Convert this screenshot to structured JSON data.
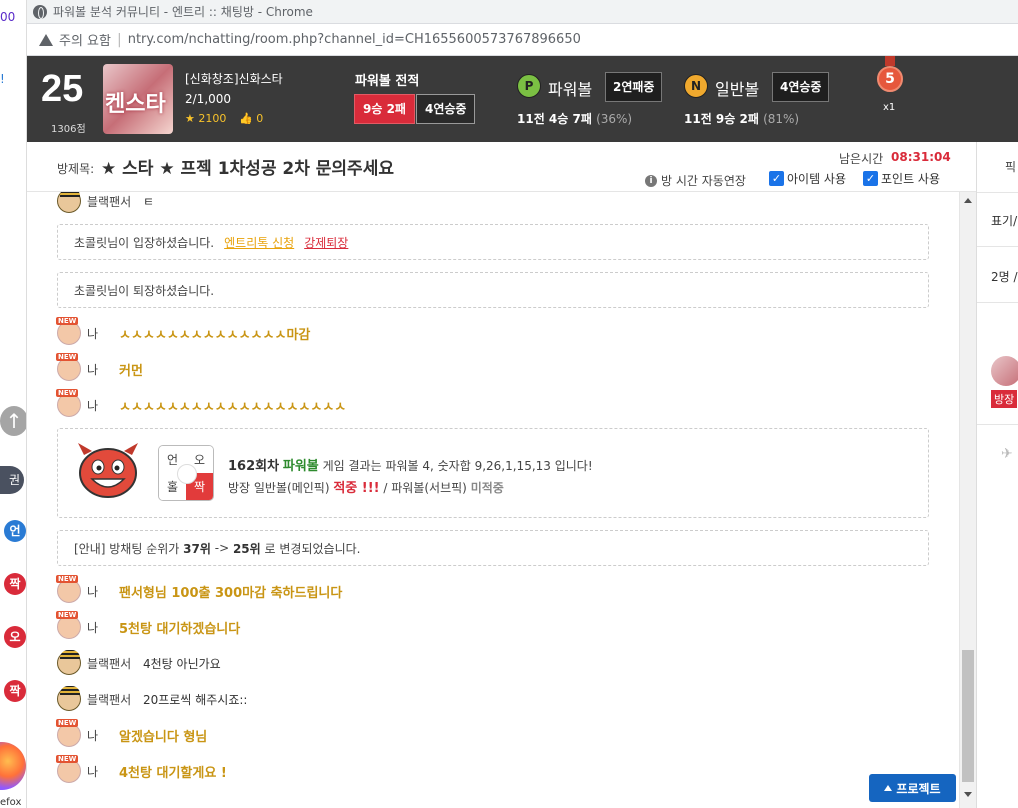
{
  "browser": {
    "window_title": "파워볼 분석 커뮤니티 - 엔트리 :: 채팅방 - Chrome",
    "security_label": "주의 요함",
    "url": "ntry.com/nchatting/room.php?channel_id=CH1655600573767896650"
  },
  "left_strip": {
    "frag1": "00",
    "frag2": "!",
    "tag": "권",
    "balls": [
      {
        "label": "언",
        "color": "#2a7bd4"
      },
      {
        "label": "짝",
        "color": "#d92b3a"
      },
      {
        "label": "오",
        "color": "#d92b3a"
      },
      {
        "label": "짝",
        "color": "#d92b3a"
      }
    ],
    "firefox_label": "efox"
  },
  "header": {
    "rank": "25",
    "points": "1306점",
    "thumb_text": "켄스타",
    "room_name": "[신화창조]신화스타",
    "member_count": "2/1,000",
    "stars": "2100",
    "likes": "0",
    "powerball_record_label": "파워볼 전적",
    "record_red": "9승 2패",
    "record_dark": "4연승중",
    "powerball": {
      "icon": "P",
      "label": "파워볼",
      "streak": "2연패중",
      "stats_main": "11전 4승 7패",
      "stats_pct": "(36%)"
    },
    "normalball": {
      "icon": "N",
      "label": "일반볼",
      "streak": "4연승중",
      "stats_main": "11전 9승 2패",
      "stats_pct": "(81%)"
    },
    "medal_num": "5",
    "medal_count": "x1"
  },
  "subheader": {
    "title_prefix": "방제목:",
    "room_title": "★ 스타 ★ 프젝 1차성공 2차 문의주세요",
    "remain_label": "남은시간",
    "remain_time": "08:31:04",
    "auto_extend": "방 시간 자동연장",
    "item_use": "아이템 사용",
    "point_use": "포인트 사용"
  },
  "chat": {
    "msg_top": {
      "nick": "블랙팬서",
      "text": "ㅌ"
    },
    "enter_notice": "초콜릿님이 입장하셨습니다.",
    "enter_link1": "엔트리톡 신청",
    "enter_link2": "강제퇴장",
    "exit_notice": "초콜릿님이 퇴장하셨습니다.",
    "me_nick": "나",
    "bp_nick": "블랙팬서",
    "new_badge": "NEW",
    "m1": "ㅅㅅㅅㅅㅅㅅㅅㅅㅅㅅㅅㅅㅅㅅ마감",
    "m2": "커먼",
    "m3": "ㅅㅅㅅㅅㅅㅅㅅㅅㅅㅅㅅㅅㅅㅅㅅㅅㅅㅅㅅ",
    "result": {
      "grid": [
        "언",
        "오",
        "홀",
        "짝"
      ],
      "round": "162회차",
      "game": "파워볼",
      "line1_rest": "게임 결과는 파워볼 4, 숫자합 9,26,1,15,13 입니다!",
      "line2_prefix": "방장 일반볼(메인픽)",
      "hit": "적중 !!!",
      "line2_mid": "/ 파워볼(서브픽)",
      "miss": "미적중"
    },
    "rank_notice": {
      "prefix": "[안내] 방채팅 순위가",
      "from": "37위",
      "arrow": "->",
      "to": "25위",
      "suffix": "로 변경되었습니다."
    },
    "m4": "팬서형님 100출 300마감 축하드립니다",
    "m5": "5천탕 대기하겠습니다",
    "bp1": "4천탕 아닌가요",
    "bp2": "20프로씩 해주시죠::",
    "m6": "알겠습니다 형님",
    "m7": "4천탕 대기할게요 !"
  },
  "project_button": "프로젝트",
  "right_panel": {
    "top": "픽",
    "show": "표기/",
    "count": "2명 /",
    "badge": "방장"
  }
}
